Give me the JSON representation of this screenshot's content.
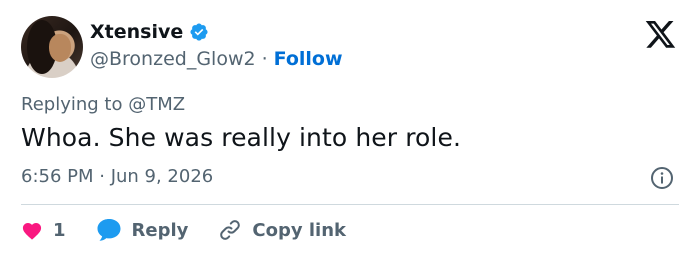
{
  "tweet": {
    "author": {
      "display_name": "Xtensive",
      "handle": "@Bronzed_Glow2",
      "verified": true
    },
    "follow_label": "Follow",
    "separator": "·",
    "replying_prefix": "Replying to",
    "replying_to": "@TMZ",
    "text": "Whoa. She was really into her role.",
    "timestamp": "6:56 PM · Jun 9, 2026",
    "likes_count": "1",
    "reply_label": "Reply",
    "copy_link_label": "Copy link"
  },
  "icons": {
    "like": "heart-icon",
    "reply": "speech-bubble-icon",
    "copy_link": "link-icon",
    "info": "info-icon",
    "logo": "x-logo-icon",
    "verified": "verified-badge-icon"
  },
  "colors": {
    "brand_blue": "#1d9bf0",
    "follow_blue": "#006fd6",
    "like_pink": "#f91880",
    "muted_text": "#536471",
    "primary_text": "#0f1419",
    "divider": "#cfd9de"
  }
}
